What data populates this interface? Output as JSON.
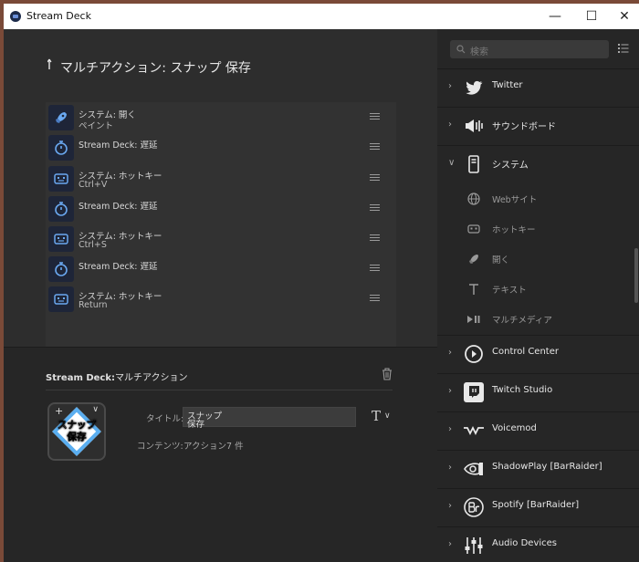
{
  "window": {
    "title": "Stream Deck"
  },
  "titlebar": {
    "min": "—",
    "max": "☐",
    "close": "✕"
  },
  "heading": "マルチアクション: スナップ 保存",
  "actions": [
    {
      "line1": "システム: 開く",
      "line2": "ペイント",
      "icon": "rocket-icon"
    },
    {
      "line1": "Stream Deck: 遅延",
      "line2": "",
      "icon": "stopwatch-icon"
    },
    {
      "line1": "システム: ホットキー",
      "line2": "Ctrl+V",
      "icon": "hotkey-icon"
    },
    {
      "line1": "Stream Deck: 遅延",
      "line2": "",
      "icon": "stopwatch-icon"
    },
    {
      "line1": "システム: ホットキー",
      "line2": "Ctrl+S",
      "icon": "hotkey-icon"
    },
    {
      "line1": "Stream Deck: 遅延",
      "line2": "",
      "icon": "stopwatch-icon"
    },
    {
      "line1": "システム: ホットキー",
      "line2": "Return",
      "icon": "hotkey-icon"
    }
  ],
  "props": {
    "plugin": "Stream Deck:",
    "action": "マルチアクション",
    "key_plus": "+",
    "key_chevron": "∨",
    "key_text_line1": "スナップ",
    "key_text_line2": "保存",
    "title_label": "タイトル:",
    "title_value_line1": "スナップ",
    "title_value_line2": "保存",
    "font_glyph": "T",
    "font_chevron": "∨",
    "content_label": "コンテンツ:",
    "content_value": "アクション7 件"
  },
  "search": {
    "placeholder": "検索"
  },
  "categories_top": [
    {
      "label": "Twitter",
      "arrow": "›",
      "icon": "twitter-icon"
    },
    {
      "label": "サウンドボード",
      "arrow": "›",
      "icon": "soundboard-icon"
    },
    {
      "label": "システム",
      "arrow": "∨",
      "icon": "system-icon"
    }
  ],
  "system_items": [
    {
      "label": "Webサイト",
      "icon": "globe-icon"
    },
    {
      "label": "ホットキー",
      "icon": "hotkey-icon"
    },
    {
      "label": "開く",
      "icon": "rocket-icon"
    },
    {
      "label": "テキスト",
      "icon": "text-icon"
    },
    {
      "label": "マルチメディア",
      "icon": "multimedia-icon"
    }
  ],
  "categories_bottom": [
    {
      "label": "Control Center",
      "arrow": "›",
      "icon": "control-center-icon"
    },
    {
      "label": "Twitch Studio",
      "arrow": "›",
      "icon": "twitch-icon"
    },
    {
      "label": "Voicemod",
      "arrow": "›",
      "icon": "voicemod-icon"
    },
    {
      "label": "ShadowPlay [BarRaider]",
      "arrow": "›",
      "icon": "nvidia-icon"
    },
    {
      "label": "Spotify [BarRaider]",
      "arrow": "›",
      "icon": "spotify-br-icon"
    },
    {
      "label": "Audio Devices",
      "arrow": "›",
      "icon": "audio-mixer-icon"
    }
  ],
  "colors": {
    "accent": "#5aaef0",
    "panel": "#2d2d2d",
    "sidebar": "#262626",
    "key_icon_bg": "#1e2538"
  }
}
